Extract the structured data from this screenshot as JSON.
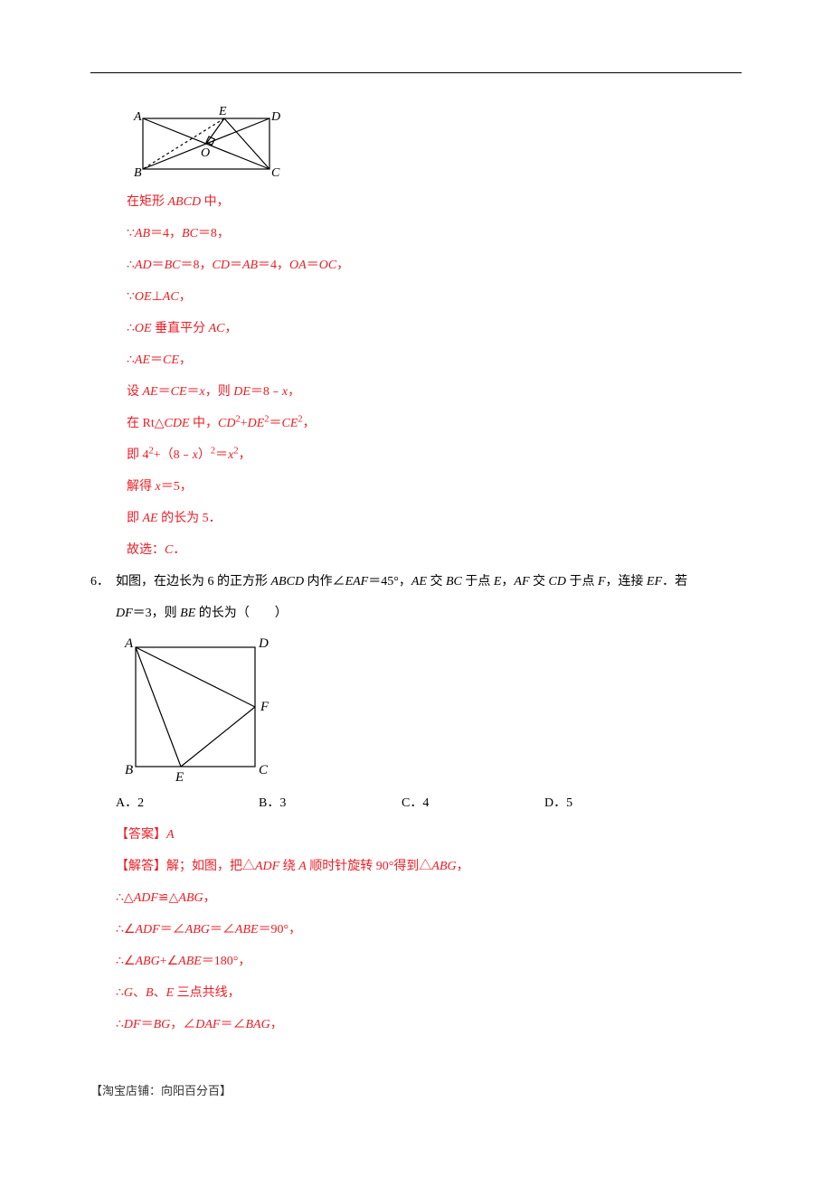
{
  "diagram5": {
    "labels": {
      "A": "A",
      "B": "B",
      "C": "C",
      "D": "D",
      "E": "E",
      "O": "O"
    }
  },
  "lines5": [
    "在矩形 <i>ABCD</i> 中，",
    "∵<i>AB</i>＝4，<i>BC</i>＝8，",
    "∴<i>AD</i>＝<i>BC</i>＝8，<i>CD</i>＝<i>AB</i>＝4，<i>OA</i>＝<i>OC</i>，",
    "∵<i>OE</i>⊥<i>AC</i>，",
    "∴<i>OE</i> 垂直平分 <i>AC</i>，",
    "∴<i>AE</i>＝<i>CE</i>，",
    "设 <i>AE</i>＝<i>CE</i>＝<i>x</i>，则 <i>DE</i>＝8﹣<i>x</i>，",
    "在 Rt△<i>CDE</i> 中，<i>CD</i><sup>2</sup>+<i>DE</i><sup>2</sup>＝<i>CE</i><sup>2</sup>，",
    "即 4<sup>2</sup>+（8﹣<i>x</i>）<sup>2</sup>＝<i>x</i><sup>2</sup>，",
    "解得 <i>x</i>＝5，",
    "即 <i>AE</i> 的长为 5．",
    "故选：<i>C</i>．"
  ],
  "q6": {
    "num": "6．",
    "text1": "如图，在边长为 6 的正方形 <i>ABCD</i> 内作∠<i>EAF</i>＝45°，<i>AE</i> 交 <i>BC</i> 于点 <i>E</i>，<i>AF</i> 交 <i>CD</i> 于点 <i>F</i>，连接 <i>EF</i>．若",
    "text2": "<i>DF</i>＝3，则 <i>BE</i> 的长为（　　）",
    "labels": {
      "A": "A",
      "B": "B",
      "C": "C",
      "D": "D",
      "E": "E",
      "F": "F"
    },
    "choices": {
      "A": "A．2",
      "B": "B．3",
      "C": "C．4",
      "D": "D．5"
    }
  },
  "lines6": [
    "【答案】<i>A</i>",
    "【解答】解；如图，把△<i>ADF</i> 绕 <i>A</i> 顺时针旋转 90°得到△<i>ABG</i>，",
    "∴△<i>ADF</i>≌△<i>ABG</i>，",
    "∴∠<i>ADF</i>＝∠<i>ABG</i>＝∠<i>ABE</i>＝90°，",
    "∴∠<i>ABG</i>+∠<i>ABE</i>＝180°，",
    "∴<i>G</i>、<i>B</i>、<i>E</i> 三点共线，",
    "∴<i>DF</i>＝<i>BG</i>，∠<i>DAF</i>＝∠<i>BAG</i>，"
  ],
  "footer": "【淘宝店铺：向阳百分百】"
}
